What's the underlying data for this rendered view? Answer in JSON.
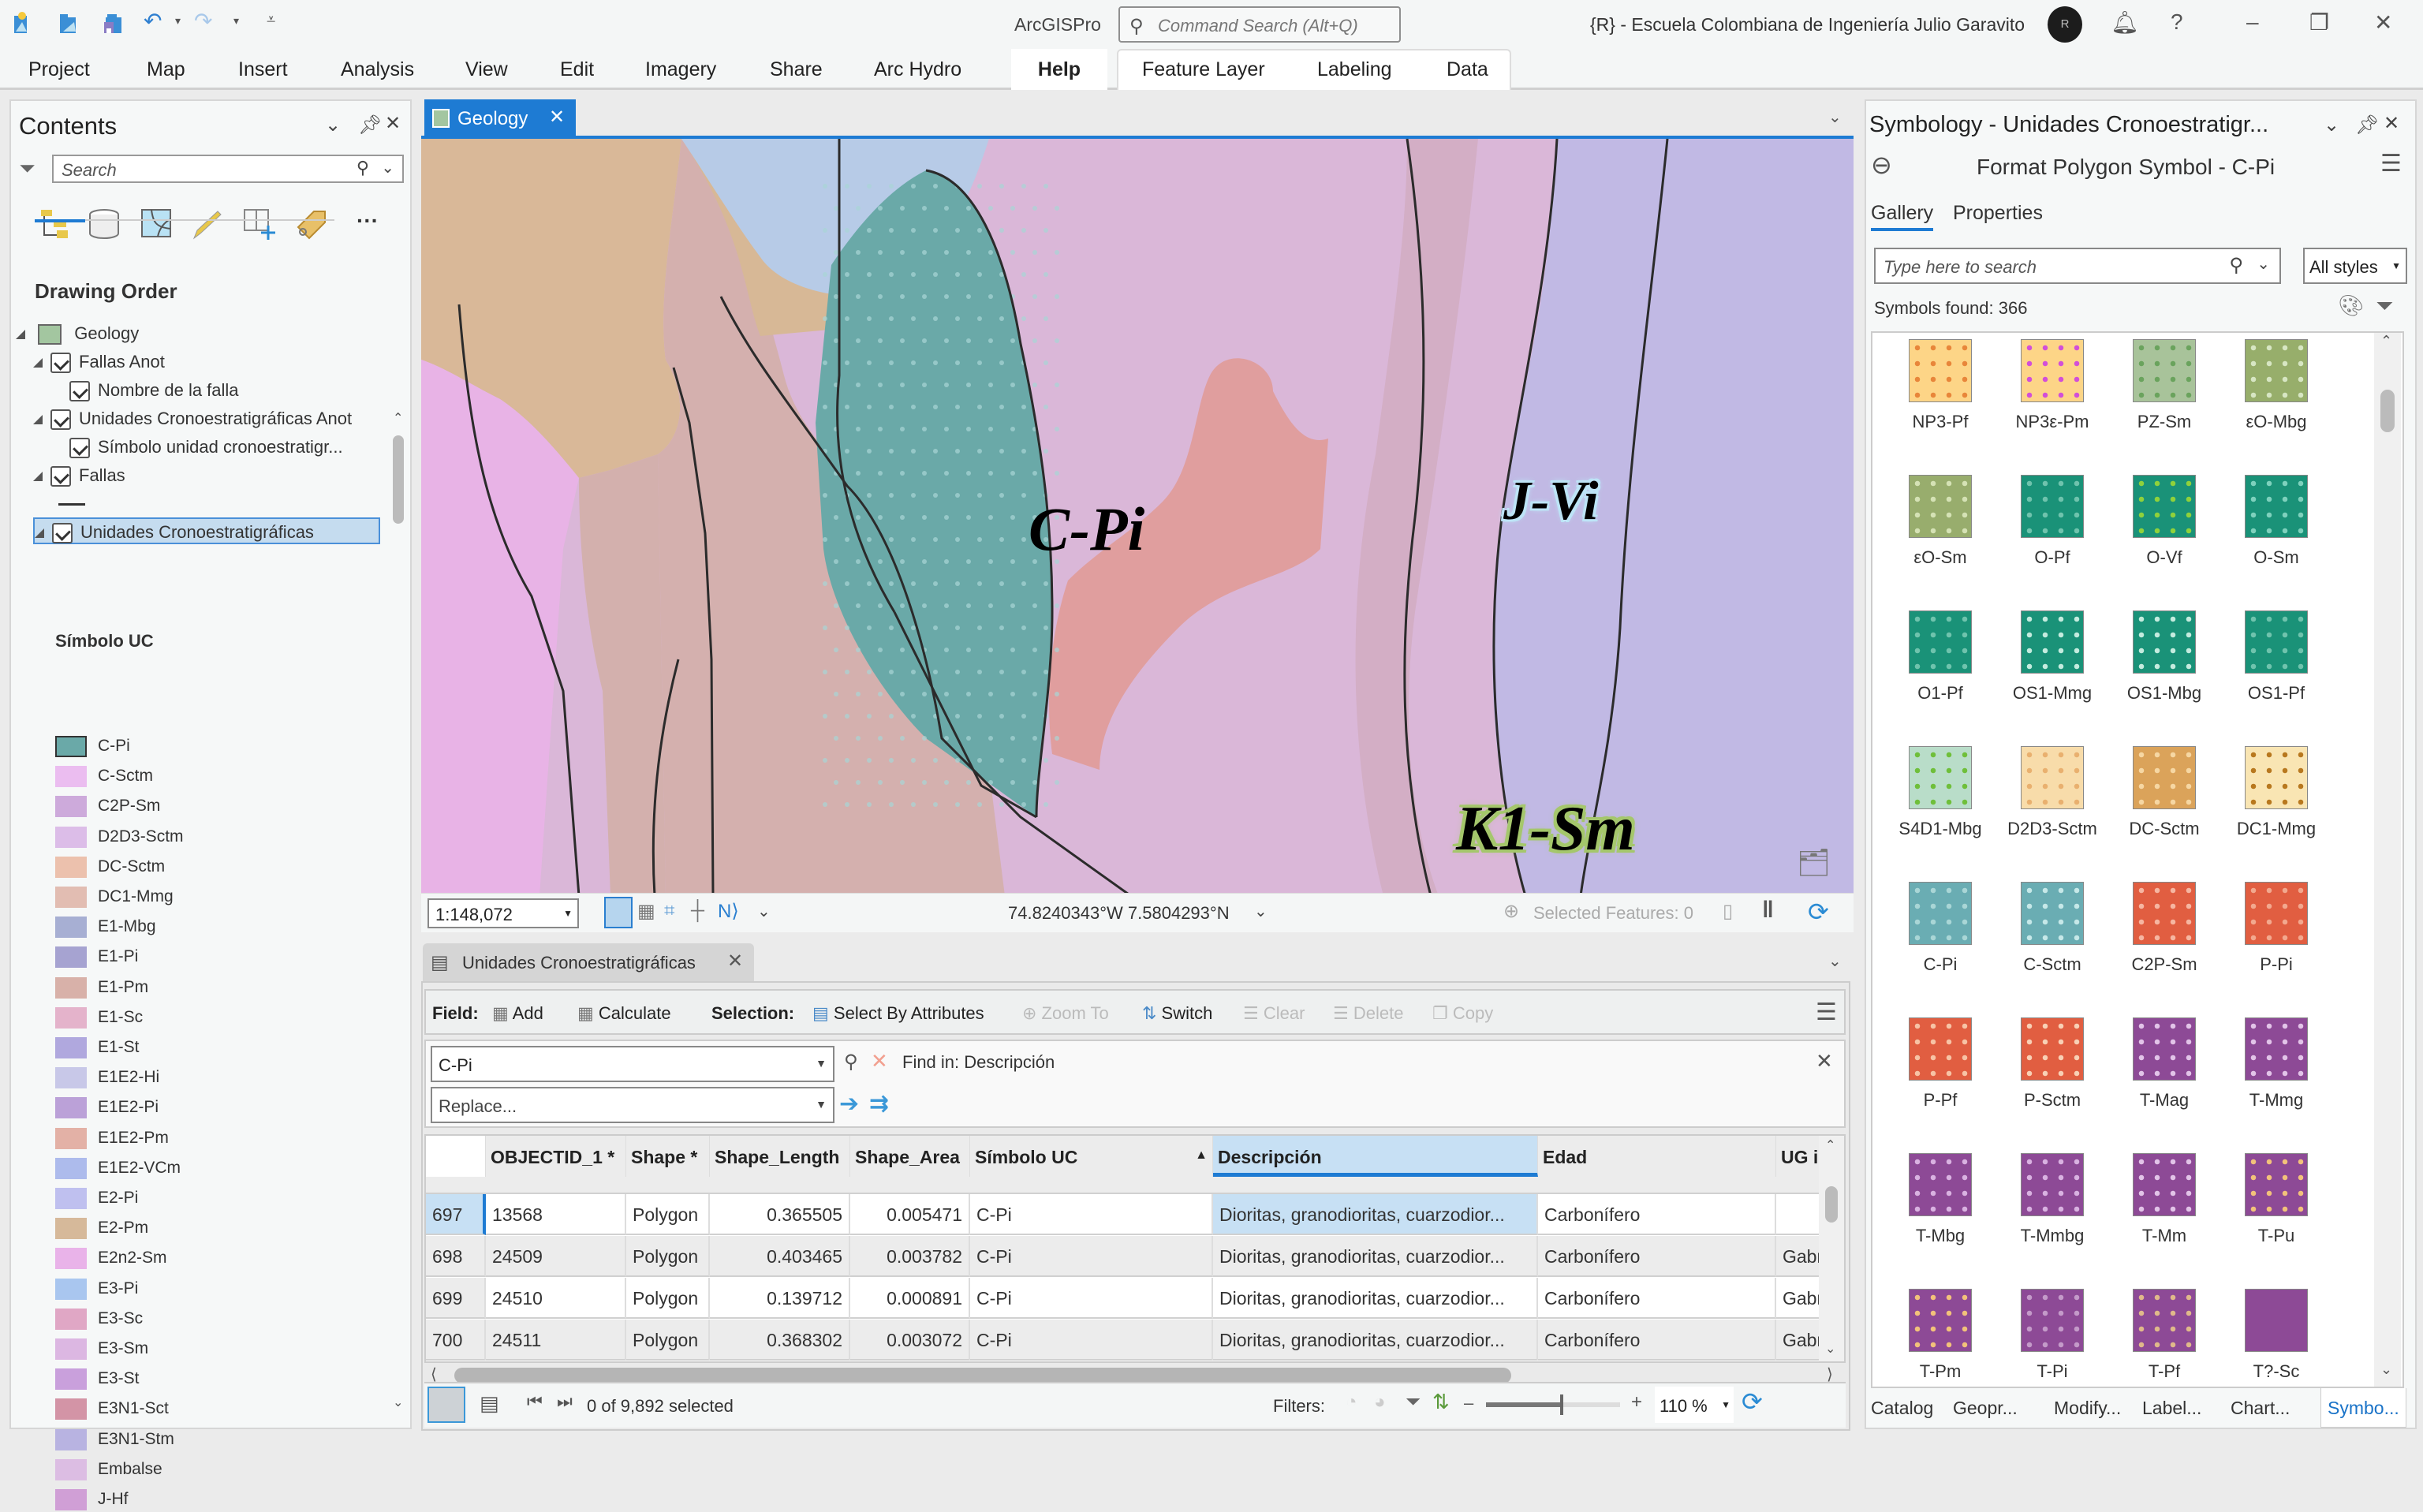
{
  "titlebar": {
    "app_name": "ArcGISPro",
    "command_search_placeholder": "Command Search (Alt+Q)",
    "org_name": "{R} - Escuela Colombiana de Ingeniería Julio Garavito",
    "avatar_initials": "R",
    "quick_access": [
      "new-project-icon",
      "open-project-icon",
      "save-project-icon",
      "undo-icon",
      "redo-icon",
      "customize-qat-icon"
    ]
  },
  "ribbon": {
    "tabs": [
      "Project",
      "Map",
      "Insert",
      "Analysis",
      "View",
      "Edit",
      "Imagery",
      "Share",
      "Arc Hydro",
      "Help"
    ],
    "active_tab": "Help",
    "contextual_tabs": [
      "Feature Layer",
      "Labeling",
      "Data"
    ]
  },
  "contents": {
    "title": "Contents",
    "search_placeholder": "Search",
    "drawing_order_label": "Drawing Order",
    "tree": [
      {
        "label": "Geology",
        "level": 0,
        "checked": null
      },
      {
        "label": "Fallas Anot",
        "level": 1,
        "checked": true
      },
      {
        "label": "Nombre de la falla",
        "level": 2,
        "checked": true
      },
      {
        "label": "Unidades Cronoestratigráficas Anot",
        "level": 1,
        "checked": true
      },
      {
        "label": "Símbolo unidad cronoestratigr...",
        "level": 2,
        "checked": true
      },
      {
        "label": "Fallas",
        "level": 1,
        "checked": true
      },
      {
        "label": "Unidades Cronoestratigráficas",
        "level": 1,
        "checked": true,
        "selected": true
      }
    ],
    "legend_field": "Símbolo UC",
    "legend": [
      {
        "label": "C-Pi",
        "color": "#6aa9a8"
      },
      {
        "label": "C-Sctm",
        "color": "#ebbdf0"
      },
      {
        "label": "C2P-Sm",
        "color": "#cdaadb"
      },
      {
        "label": "D2D3-Sctm",
        "color": "#dcbde8"
      },
      {
        "label": "DC-Sctm",
        "color": "#ecc1ad"
      },
      {
        "label": "DC1-Mmg",
        "color": "#e2bdb2"
      },
      {
        "label": "E1-Mbg",
        "color": "#a7afd3"
      },
      {
        "label": "E1-Pi",
        "color": "#a6a3d1"
      },
      {
        "label": "E1-Pm",
        "color": "#d8b1a9"
      },
      {
        "label": "E1-Sc",
        "color": "#e4b3cb"
      },
      {
        "label": "E1-St",
        "color": "#b0a8de"
      },
      {
        "label": "E1E2-Hi",
        "color": "#c8c8e8"
      },
      {
        "label": "E1E2-Pi",
        "color": "#bba1d8"
      },
      {
        "label": "E1E2-Pm",
        "color": "#e3b1a6"
      },
      {
        "label": "E1E2-VCm",
        "color": "#adbbec"
      },
      {
        "label": "E2-Pi",
        "color": "#bfc0ef"
      },
      {
        "label": "E2-Pm",
        "color": "#d6b99a"
      },
      {
        "label": "E2n2-Sm",
        "color": "#e9b3e9"
      },
      {
        "label": "E3-Pi",
        "color": "#a9c6ef"
      },
      {
        "label": "E3-Sc",
        "color": "#e0a7c5"
      },
      {
        "label": "E3-Sm",
        "color": "#dcb7e2"
      },
      {
        "label": "E3-St",
        "color": "#c9a0dc"
      },
      {
        "label": "E3N1-Sct",
        "color": "#d394a6"
      },
      {
        "label": "E3N1-Stm",
        "color": "#b8b3e1"
      },
      {
        "label": "Embalse",
        "color": "#dcbde3"
      },
      {
        "label": "J-Hf",
        "color": "#d09fd6"
      }
    ]
  },
  "map": {
    "tab_label": "Geology",
    "labels": [
      {
        "text": "C-Pi",
        "halo": "none"
      },
      {
        "text": "J-Vi",
        "halo": "#bde4f6"
      },
      {
        "text": "K1-Sm",
        "halo": "#a5c76c"
      }
    ],
    "scale": "1:148,072",
    "coordinates": "74.8240343°W 7.5804293°N",
    "selected_features": "Selected Features: 0"
  },
  "attribute_table": {
    "tab_label": "Unidades Cronoestratigráficas",
    "toolbar": {
      "field_label": "Field:",
      "add": "Add",
      "calculate": "Calculate",
      "selection_label": "Selection:",
      "select_by_attributes": "Select By Attributes",
      "zoom_to": "Zoom To",
      "switch": "Switch",
      "clear": "Clear",
      "delete": "Delete",
      "copy": "Copy"
    },
    "find": {
      "value": "C-Pi",
      "find_in": "Find in: Descripción",
      "replace_placeholder": "Replace..."
    },
    "columns": [
      "OBJECTID_1 *",
      "Shape *",
      "Shape_Length",
      "Shape_Area",
      "Símbolo UC",
      "Descripción",
      "Edad",
      "UG inte"
    ],
    "rows": [
      {
        "row": "697",
        "objectid": "13568",
        "shape": "Polygon",
        "length": "0.365505",
        "area": "0.005471",
        "simbolo": "C-Pi",
        "descripcion": "Dioritas, granodioritas, cuarzodior...",
        "edad": "Carbonífero",
        "ug": ""
      },
      {
        "row": "698",
        "objectid": "24509",
        "shape": "Polygon",
        "length": "0.403465",
        "area": "0.003782",
        "simbolo": "C-Pi",
        "descripcion": "Dioritas, granodioritas, cuarzodior...",
        "edad": "Carbonífero",
        "ug": "Gabro c"
      },
      {
        "row": "699",
        "objectid": "24510",
        "shape": "Polygon",
        "length": "0.139712",
        "area": "0.000891",
        "simbolo": "C-Pi",
        "descripcion": "Dioritas, granodioritas, cuarzodior...",
        "edad": "Carbonífero",
        "ug": "Gabro c"
      },
      {
        "row": "700",
        "objectid": "24511",
        "shape": "Polygon",
        "length": "0.368302",
        "area": "0.003072",
        "simbolo": "C-Pi",
        "descripcion": "Dioritas, granodioritas, cuarzodior...",
        "edad": "Carbonífero",
        "ug": "Gabro c"
      }
    ],
    "selection_status": "0 of 9,892 selected",
    "filters_label": "Filters:",
    "zoom_level": "110 %",
    "zoom_fraction": 0.55
  },
  "symbology": {
    "title": "Symbology - Unidades Cronoestratigr...",
    "subtitle": "Format Polygon Symbol - C-Pi",
    "tabs": [
      "Gallery",
      "Properties"
    ],
    "active_tab": "Gallery",
    "search_placeholder": "Type here to search",
    "style_filter": "All styles",
    "symbols_found": "Symbols found: 366",
    "gallery": [
      {
        "label": "NP3-Pf",
        "color": "#fdd587",
        "fg": "#e8863a"
      },
      {
        "label": "NP3ε-Pm",
        "color": "#fdd587",
        "fg": "#d24fd8"
      },
      {
        "label": "PZ-Sm",
        "color": "#a8c39a",
        "fg": "#6aa35d"
      },
      {
        "label": "εO-Mbg",
        "color": "#97ae6b",
        "fg": "#d7e6c3"
      },
      {
        "label": "εO-Sm",
        "color": "#98ad6d",
        "fg": "#d5e2b5"
      },
      {
        "label": "O-Pf",
        "color": "#1a9278",
        "fg": "#6fc3ad"
      },
      {
        "label": "O-Vf",
        "color": "#1a9278",
        "fg": "#8fd13b"
      },
      {
        "label": "O-Sm",
        "color": "#1a9278",
        "fg": "#7ed1bd"
      },
      {
        "label": "O1-Pf",
        "color": "#1a9278",
        "fg": "#6fc3ad"
      },
      {
        "label": "OS1-Mmg",
        "color": "#1a9278",
        "fg": "#c4ebde"
      },
      {
        "label": "OS1-Mbg",
        "color": "#1a9278",
        "fg": "#c4ebde"
      },
      {
        "label": "OS1-Pf",
        "color": "#1a9278",
        "fg": "#6fc3ad"
      },
      {
        "label": "S4D1-Mbg",
        "color": "#b9ddc9",
        "fg": "#6fbf3a"
      },
      {
        "label": "D2D3-Sctm",
        "color": "#f8dcaa",
        "fg": "#e9b06f"
      },
      {
        "label": "DC-Sctm",
        "color": "#dba35a",
        "fg": "#f6d7a3"
      },
      {
        "label": "DC1-Mmg",
        "color": "#f9e5b3",
        "fg": "#b8781e"
      },
      {
        "label": "C-Pi",
        "color": "#6aadb3",
        "fg": "#a9d6d6"
      },
      {
        "label": "C-Sctm",
        "color": "#6aadb3",
        "fg": "#c6e8e8"
      },
      {
        "label": "C2P-Sm",
        "color": "#e15e41",
        "fg": "#f6b6a1"
      },
      {
        "label": "P-Pi",
        "color": "#e15e41",
        "fg": "#f2a88e"
      },
      {
        "label": "P-Pf",
        "color": "#e15e41",
        "fg": "#f7c3a5"
      },
      {
        "label": "P-Sctm",
        "color": "#e15e41",
        "fg": "#f8d0b5"
      },
      {
        "label": "T-Mag",
        "color": "#8d4a96",
        "fg": "#e2c4e8"
      },
      {
        "label": "T-Mmg",
        "color": "#8d4a96",
        "fg": "#e2c4e8"
      },
      {
        "label": "T-Mbg",
        "color": "#8d4a96",
        "fg": "#d9b2e1"
      },
      {
        "label": "T-Mmbg",
        "color": "#8d4a96",
        "fg": "#d9b2e1"
      },
      {
        "label": "T-Mm",
        "color": "#8d4a96",
        "fg": "#e2c4e8"
      },
      {
        "label": "T-Pu",
        "color": "#8d4a96",
        "fg": "#f2c27a"
      },
      {
        "label": "T-Pm",
        "color": "#8d4a96",
        "fg": "#f2c27a"
      },
      {
        "label": "T-Pi",
        "color": "#8d4a96",
        "fg": "#c49ac9"
      },
      {
        "label": "T-Pf",
        "color": "#8d4a96",
        "fg": "#e0b98a"
      },
      {
        "label": "T?-Sc",
        "color": "#8d4a96",
        "fg": "#8d4a96"
      }
    ]
  },
  "bottom_tabs": [
    "Catalog",
    "Geopr...",
    "Modify...",
    "Label...",
    "Chart...",
    "Symbo..."
  ],
  "bottom_active": "Symbo..."
}
